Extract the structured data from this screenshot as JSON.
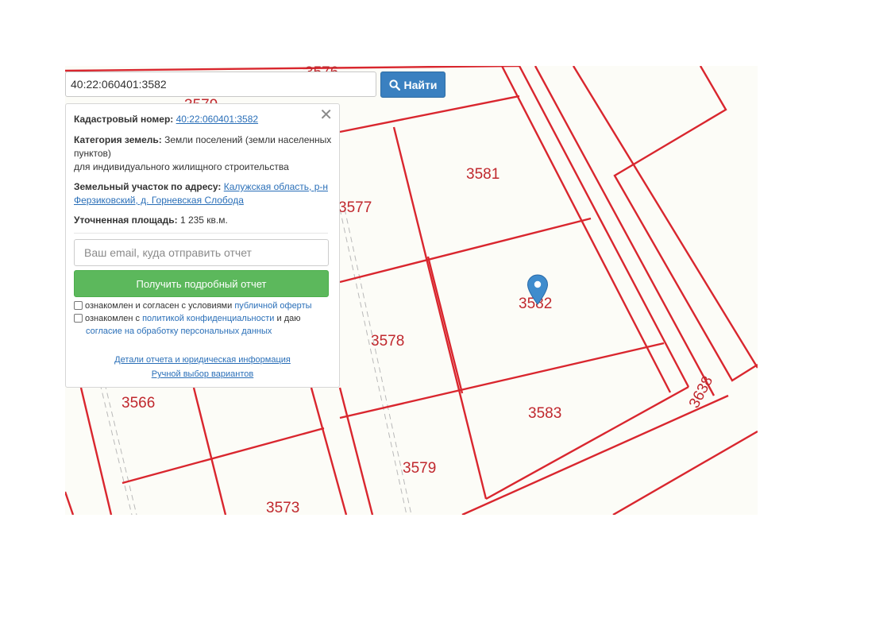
{
  "search": {
    "value": "40:22:060401:3582",
    "button_label": "Найти"
  },
  "info": {
    "cadastral_label": "Кадастровый номер:",
    "cadastral_value": "40:22:060401:3582",
    "category_label": "Категория земель:",
    "category_value": "Земли поселений (земли населенных пунктов)",
    "category_purpose": "для индивидуального жилищного строительства",
    "address_label": "Земельный участок по адресу:",
    "address_value": "Калужская область, р-н Ферзиковский, д. Горневская Слобода",
    "area_label": "Уточненная площадь:",
    "area_value": "1 235 кв.м."
  },
  "report": {
    "email_placeholder": "Ваш email, куда отправить отчет",
    "button_label": "Получить подробный отчет",
    "agree1_text": "ознакомлен и согласен с условиями",
    "agree1_link": "публичной оферты",
    "agree2_text": "ознакомлен с",
    "agree2_link": "политикой конфиденциальности",
    "agree2_mid": "и даю",
    "agree2_link2": "согласие на обработку персональных данных",
    "details_link": "Детали отчета и юридическая информация",
    "manual_link": "Ручной выбор вариантов"
  },
  "map": {
    "parcels": [
      "3576",
      "3579",
      "3577",
      "3581",
      "3582",
      "3578",
      "3583",
      "3566",
      "3579",
      "3573",
      "3638"
    ],
    "line_color": "#d9262e"
  }
}
